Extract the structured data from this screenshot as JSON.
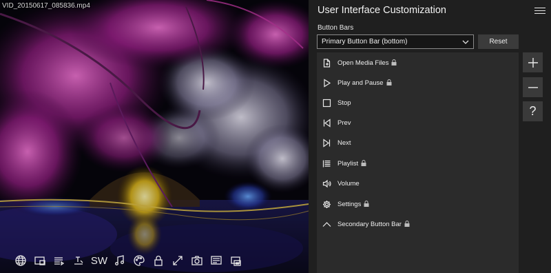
{
  "video": {
    "filename": "VID_20150617_085836.mp4",
    "toolbar": [
      {
        "icon": "globe-icon"
      },
      {
        "icon": "picture-in-picture-icon"
      },
      {
        "icon": "playlist-icon"
      },
      {
        "icon": "subtitle-icon"
      },
      {
        "icon": "sw-decoder-text",
        "text": "SW"
      },
      {
        "icon": "music-note-icon"
      },
      {
        "icon": "palette-icon"
      },
      {
        "icon": "lock-icon"
      },
      {
        "icon": "fullscreen-icon"
      },
      {
        "icon": "screenshot-camera-icon"
      },
      {
        "icon": "display-icon"
      },
      {
        "icon": "cast-icon"
      }
    ]
  },
  "panel": {
    "title": "User Interface Customization",
    "section_label": "Button Bars",
    "dropdown_value": "Primary Button Bar (bottom)",
    "reset_label": "Reset",
    "items": [
      {
        "label": "Open Media Files",
        "icon": "file-icon",
        "locked": true
      },
      {
        "label": "Play and Pause",
        "icon": "play-icon",
        "locked": true
      },
      {
        "label": "Stop",
        "icon": "stop-icon",
        "locked": false
      },
      {
        "label": "Prev",
        "icon": "skip-previous-icon",
        "locked": false
      },
      {
        "label": "Next",
        "icon": "skip-next-icon",
        "locked": false
      },
      {
        "label": "Playlist",
        "icon": "playlist-icon",
        "locked": true
      },
      {
        "label": "Volume",
        "icon": "volume-icon",
        "locked": false
      },
      {
        "label": "Settings",
        "icon": "gear-icon",
        "locked": true
      },
      {
        "label": "Secondary Button Bar",
        "icon": "chevron-up-icon",
        "locked": true
      }
    ],
    "side_buttons": [
      {
        "icon": "plus-icon"
      },
      {
        "icon": "minus-icon"
      },
      {
        "icon": "help-icon",
        "text": "?"
      }
    ]
  },
  "colors": {
    "panel_bg": "#1f1f1f",
    "list_bg": "#2b2b2b",
    "button_bg": "#3a3a3a"
  }
}
